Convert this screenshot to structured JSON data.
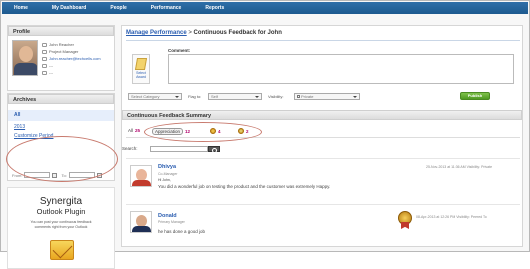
{
  "nav": {
    "items": [
      "Home",
      "My Dashboard",
      "People",
      "Performance",
      "Reports"
    ]
  },
  "profile": {
    "heading": "Profile",
    "name": "John Reacher",
    "title": "Project Manager",
    "email": "John.reacher@techcells.com",
    "line4": "---",
    "line5": "---"
  },
  "archives": {
    "heading": "Archives",
    "items": [
      "All",
      "2013",
      "Customize Period"
    ],
    "from_label": "From:",
    "to_label": "To:"
  },
  "plugin": {
    "title": "Synergita",
    "subtitle": "Outlook Plugin",
    "description": "You can post your continuous feedback comments right from your Outlook"
  },
  "breadcrumb": {
    "link": "Manage Performance",
    "separator": " > ",
    "current": "Continuous Feedback for John"
  },
  "composer": {
    "comment_label": "Comment:",
    "award_label": "Select Award",
    "category_select": "Select Category",
    "flag_label": "Flag to:",
    "flag_value": "Self",
    "visibility_label": "Visibility:",
    "visibility_value": "Private",
    "publish_label": "Publish"
  },
  "summary": {
    "heading": "Continuous Feedback Summary",
    "all_label": "All",
    "all_count": "25",
    "appreciation_label": "Appreciation",
    "appreciation_count": "12",
    "medal1_count": "4",
    "medal2_count": "2"
  },
  "search": {
    "label": "Search:"
  },
  "feed": [
    {
      "name": "Dhivya",
      "role": "Co-Manager",
      "salutation": "Hi John,",
      "text": "You did a wonderful job on testing the product and the customer was extremely Happy.",
      "meta": "25-Nov-2013 at 11:36 AM Visibility: Private",
      "avatar_colors": {
        "head": "#e9b59a",
        "body": "#c23b2d",
        "bg": "#f1e6dd"
      }
    },
    {
      "name": "Donald",
      "role": "Primary Manager",
      "text": "he has done a good job",
      "meta": "08-Apr-2013 at 12:26 PM Visibility: Peered To",
      "avatar_colors": {
        "head": "#d9a98a",
        "body": "#1f2f55",
        "bg": "#e6ebf3"
      }
    }
  ],
  "colors": {
    "nav_bg": "#1d5a8f",
    "link": "#2a5db0",
    "publish": "#5aa62b",
    "count": "#b0006a",
    "highlight_ellipse": "#c87a6e"
  }
}
